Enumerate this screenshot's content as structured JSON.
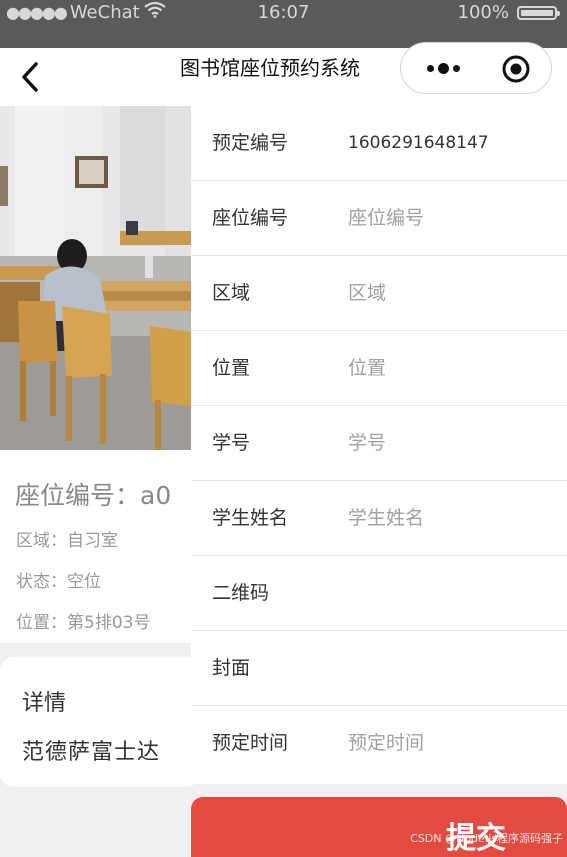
{
  "status_bar": {
    "signal": "●●●●●",
    "carrier": "WeChat",
    "time": "16:07",
    "battery": "100%"
  },
  "nav": {
    "title": "图书馆座位预约系统"
  },
  "seat": {
    "seat_no": "座位编号：a0",
    "area": "区域：自习室",
    "status": "状态：空位",
    "position": "位置：第5排03号"
  },
  "detail": {
    "title": "详情",
    "body": "范德萨富士达"
  },
  "form": {
    "fields": [
      {
        "label": "预定编号",
        "value": "1606291648147"
      },
      {
        "label": "座位编号",
        "placeholder": "座位编号"
      },
      {
        "label": "区域",
        "placeholder": "区域"
      },
      {
        "label": "位置",
        "placeholder": "位置"
      },
      {
        "label": "学号",
        "placeholder": "学号"
      },
      {
        "label": "学生姓名",
        "placeholder": "学生姓名"
      },
      {
        "label": "二维码"
      },
      {
        "label": "封面"
      },
      {
        "label": "预定时间",
        "placeholder": "预定时间"
      }
    ]
  },
  "submit": {
    "label": "提交"
  },
  "watermark": "CSDN @Node.js程序源码强子",
  "colors": {
    "submit": "#e24b40",
    "status_bar": "#5a5a5a"
  }
}
